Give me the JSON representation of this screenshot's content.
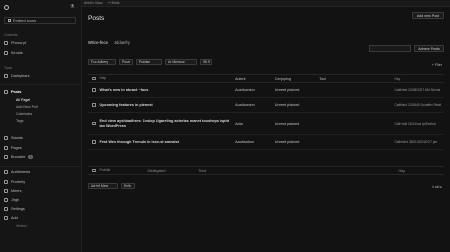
{
  "topbar": {
    "crumbs": [
      "Ahhtrv hfaw",
      "++Bdds"
    ]
  },
  "sidebar": {
    "site_label": "Embed icons",
    "section1": "Contents",
    "items1": [
      {
        "label": "Phono:yt"
      },
      {
        "label": "Kiroids"
      }
    ],
    "section2": "Tools",
    "items2": [
      {
        "label": "Darlephars"
      }
    ],
    "posts_label": "Posts",
    "posts_sub": [
      "All Pagel",
      "Add New Poll",
      "Catehnles",
      "Tags"
    ],
    "items3": [
      {
        "label": "Stands"
      },
      {
        "label": "Pages"
      },
      {
        "label": "Broudeir",
        "badge": "1"
      }
    ],
    "items4": [
      {
        "label": "Authtments"
      },
      {
        "label": "Prorlerly"
      },
      {
        "label": "Meers"
      },
      {
        "label": "Jirgh"
      },
      {
        "label": "Settings"
      },
      {
        "label": "Add"
      }
    ],
    "footer": "Wintwrt"
  },
  "header": {
    "title": "Posts",
    "add_new": "Add new Post"
  },
  "subtabs": [
    "Wrice-fece",
    "Jddaefry"
  ],
  "search": {
    "button": "Adnere Posts"
  },
  "filters": {
    "dates": "Foc Adbery",
    "cat": "Postr",
    "all": "Publise",
    "author": "Ar Mentour",
    "apply": "Sfl.fl"
  },
  "help_link": "+ Filer",
  "table": {
    "headers": [
      "Hdp",
      "Autent",
      "Cenjoping",
      "Tool",
      "Hay"
    ],
    "rows": [
      {
        "title": "What's new in nbract ~fucs",
        "author": "Austicanion",
        "cat": "Unreet plained",
        "tags": "",
        "date": "Catfinted 23/08/2027 AM Siumia"
      },
      {
        "title": "Upcoming features in plenest",
        "author": "Austicanion",
        "cat": "Unreet plained",
        "tags": "",
        "date": "Catfiniud 120/845 Scoaffex Reurl"
      },
      {
        "title": "End view ayshbadhres: 1vslop Ugareling acterlas manet toosheps ispht ian WordPress",
        "author": "Adla",
        "cat": "Unrest plained",
        "tags": "",
        "date": "Calt+cdd 25/14/ms Ip/Exetnd"
      },
      {
        "title": "Fest Wes through Trenuls in lsse-st amnalst",
        "author": "Aautlsation",
        "cat": "Unreet plained",
        "tags": "",
        "date": "Calhlmird 28/01/2024/07/7 pm"
      }
    ],
    "footer": [
      "Publist",
      "Distiegated",
      "Tond",
      "Hay"
    ]
  },
  "bulk": {
    "label": "Ad+ef Mew",
    "apply": "Enlb"
  },
  "pagination": "4 ald ▸"
}
